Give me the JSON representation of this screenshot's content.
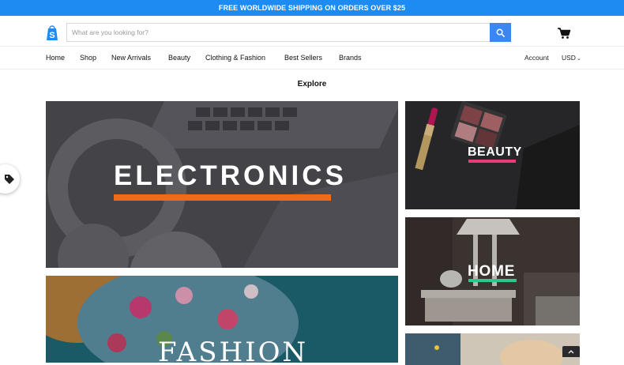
{
  "announcement": {
    "text": "FREE WORLDWIDE SHIPPING ON ORDERS OVER $25"
  },
  "header": {
    "logo_icon": "shopping-bag-s-logo",
    "search": {
      "placeholder": "What are you looking for?",
      "value": "",
      "icon": "search-icon"
    },
    "cart_icon": "cart-icon"
  },
  "nav": {
    "items": [
      {
        "label": "Home"
      },
      {
        "label": "Shop"
      },
      {
        "label": "New Arrivals"
      },
      {
        "label": "Beauty"
      },
      {
        "label": "Clothing & Fashion"
      },
      {
        "label": "Best Sellers"
      },
      {
        "label": "Brands"
      }
    ],
    "account_label": "Account",
    "currency_label": "USD"
  },
  "section": {
    "title": "Explore"
  },
  "tiles": {
    "electronics": {
      "title": "ELECTRONICS",
      "accent": "#ef6b18"
    },
    "fashion": {
      "title": "FASHION"
    },
    "beauty": {
      "title": "BEAUTY",
      "accent": "#e63c7a"
    },
    "home": {
      "title": "HOME",
      "accent": "#2fc78c"
    }
  },
  "colors": {
    "announcement_bg": "#1d8bf1",
    "search_button": "#3a86f5",
    "logo": "#1d8bf1"
  }
}
